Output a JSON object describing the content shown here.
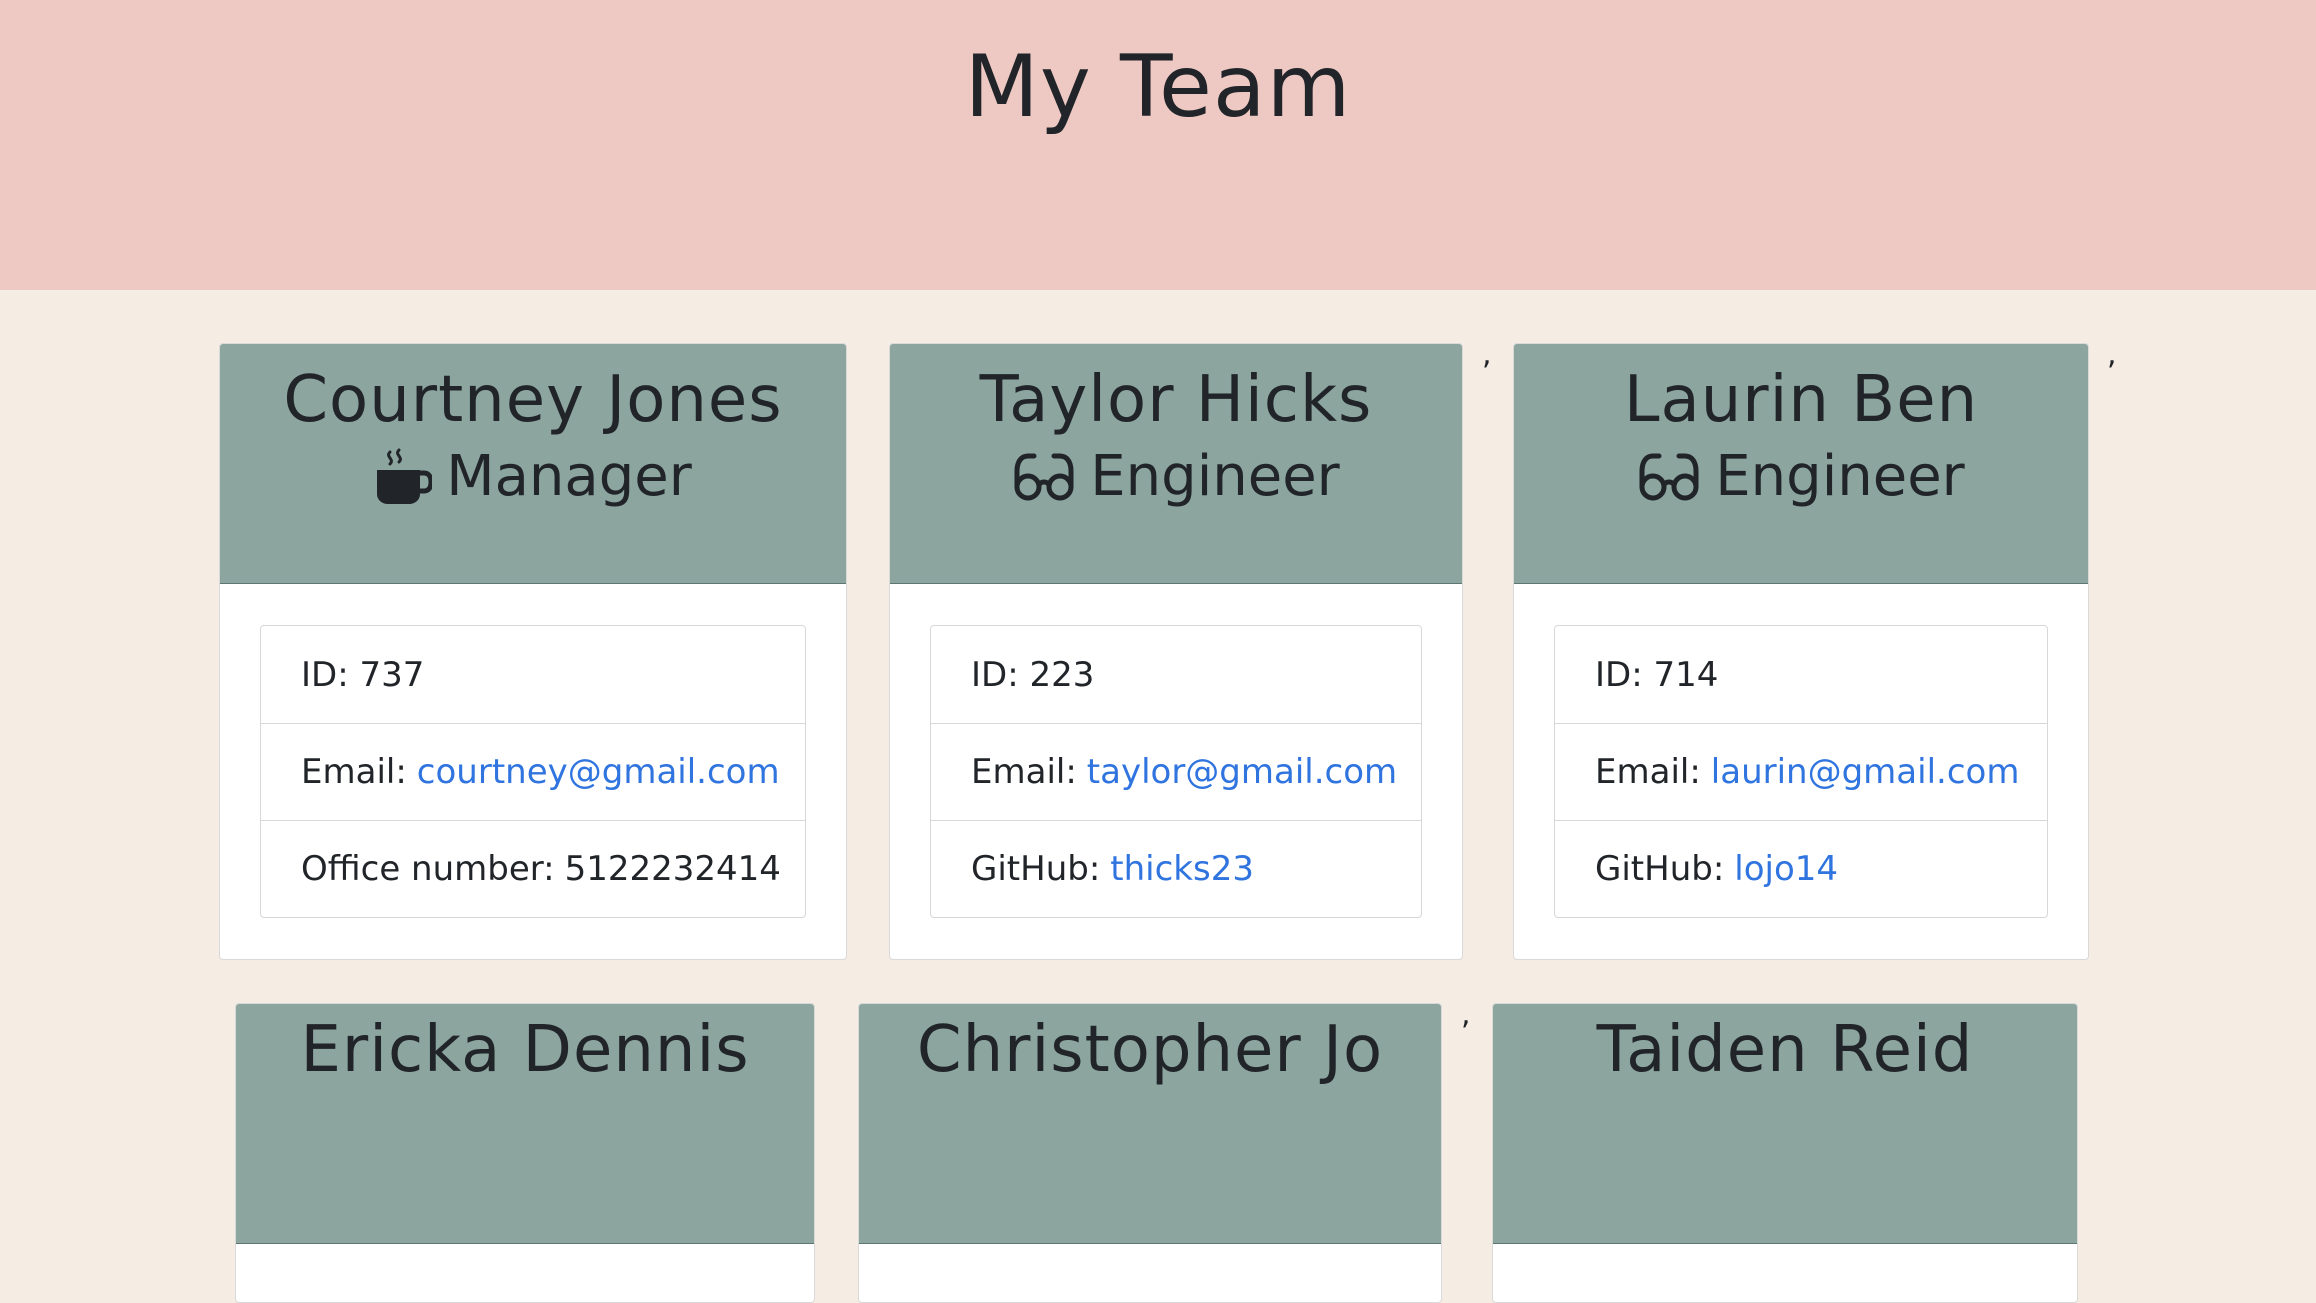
{
  "header": {
    "title": "My Team"
  },
  "cards": [
    {
      "name": "Courtney Jones",
      "role": "Manager",
      "role_icon": "coffee-mug-icon",
      "id_text": "ID: 737",
      "email_label": "Email:",
      "email": "courtney@gmail.com",
      "extra_label": "Office number:",
      "extra_value": "5122232414"
    },
    {
      "name": "Taylor Hicks",
      "role": "Engineer",
      "role_icon": "glasses-icon",
      "id_text": "ID: 223",
      "email_label": "Email:",
      "email": "taylor@gmail.com",
      "extra_label": "GitHub:",
      "extra_value": "thicks23"
    },
    {
      "name": "Laurin Ben",
      "role": "Engineer",
      "role_icon": "glasses-icon",
      "id_text": "ID: 714",
      "email_label": "Email:",
      "email": "laurin@gmail.com",
      "extra_label": "GitHub:",
      "extra_value": "lojo14"
    }
  ],
  "partial_cards": [
    {
      "name": "Ericka Dennis"
    },
    {
      "name": "Christopher Jo"
    },
    {
      "name": "Taiden Reid"
    }
  ],
  "separator": ","
}
